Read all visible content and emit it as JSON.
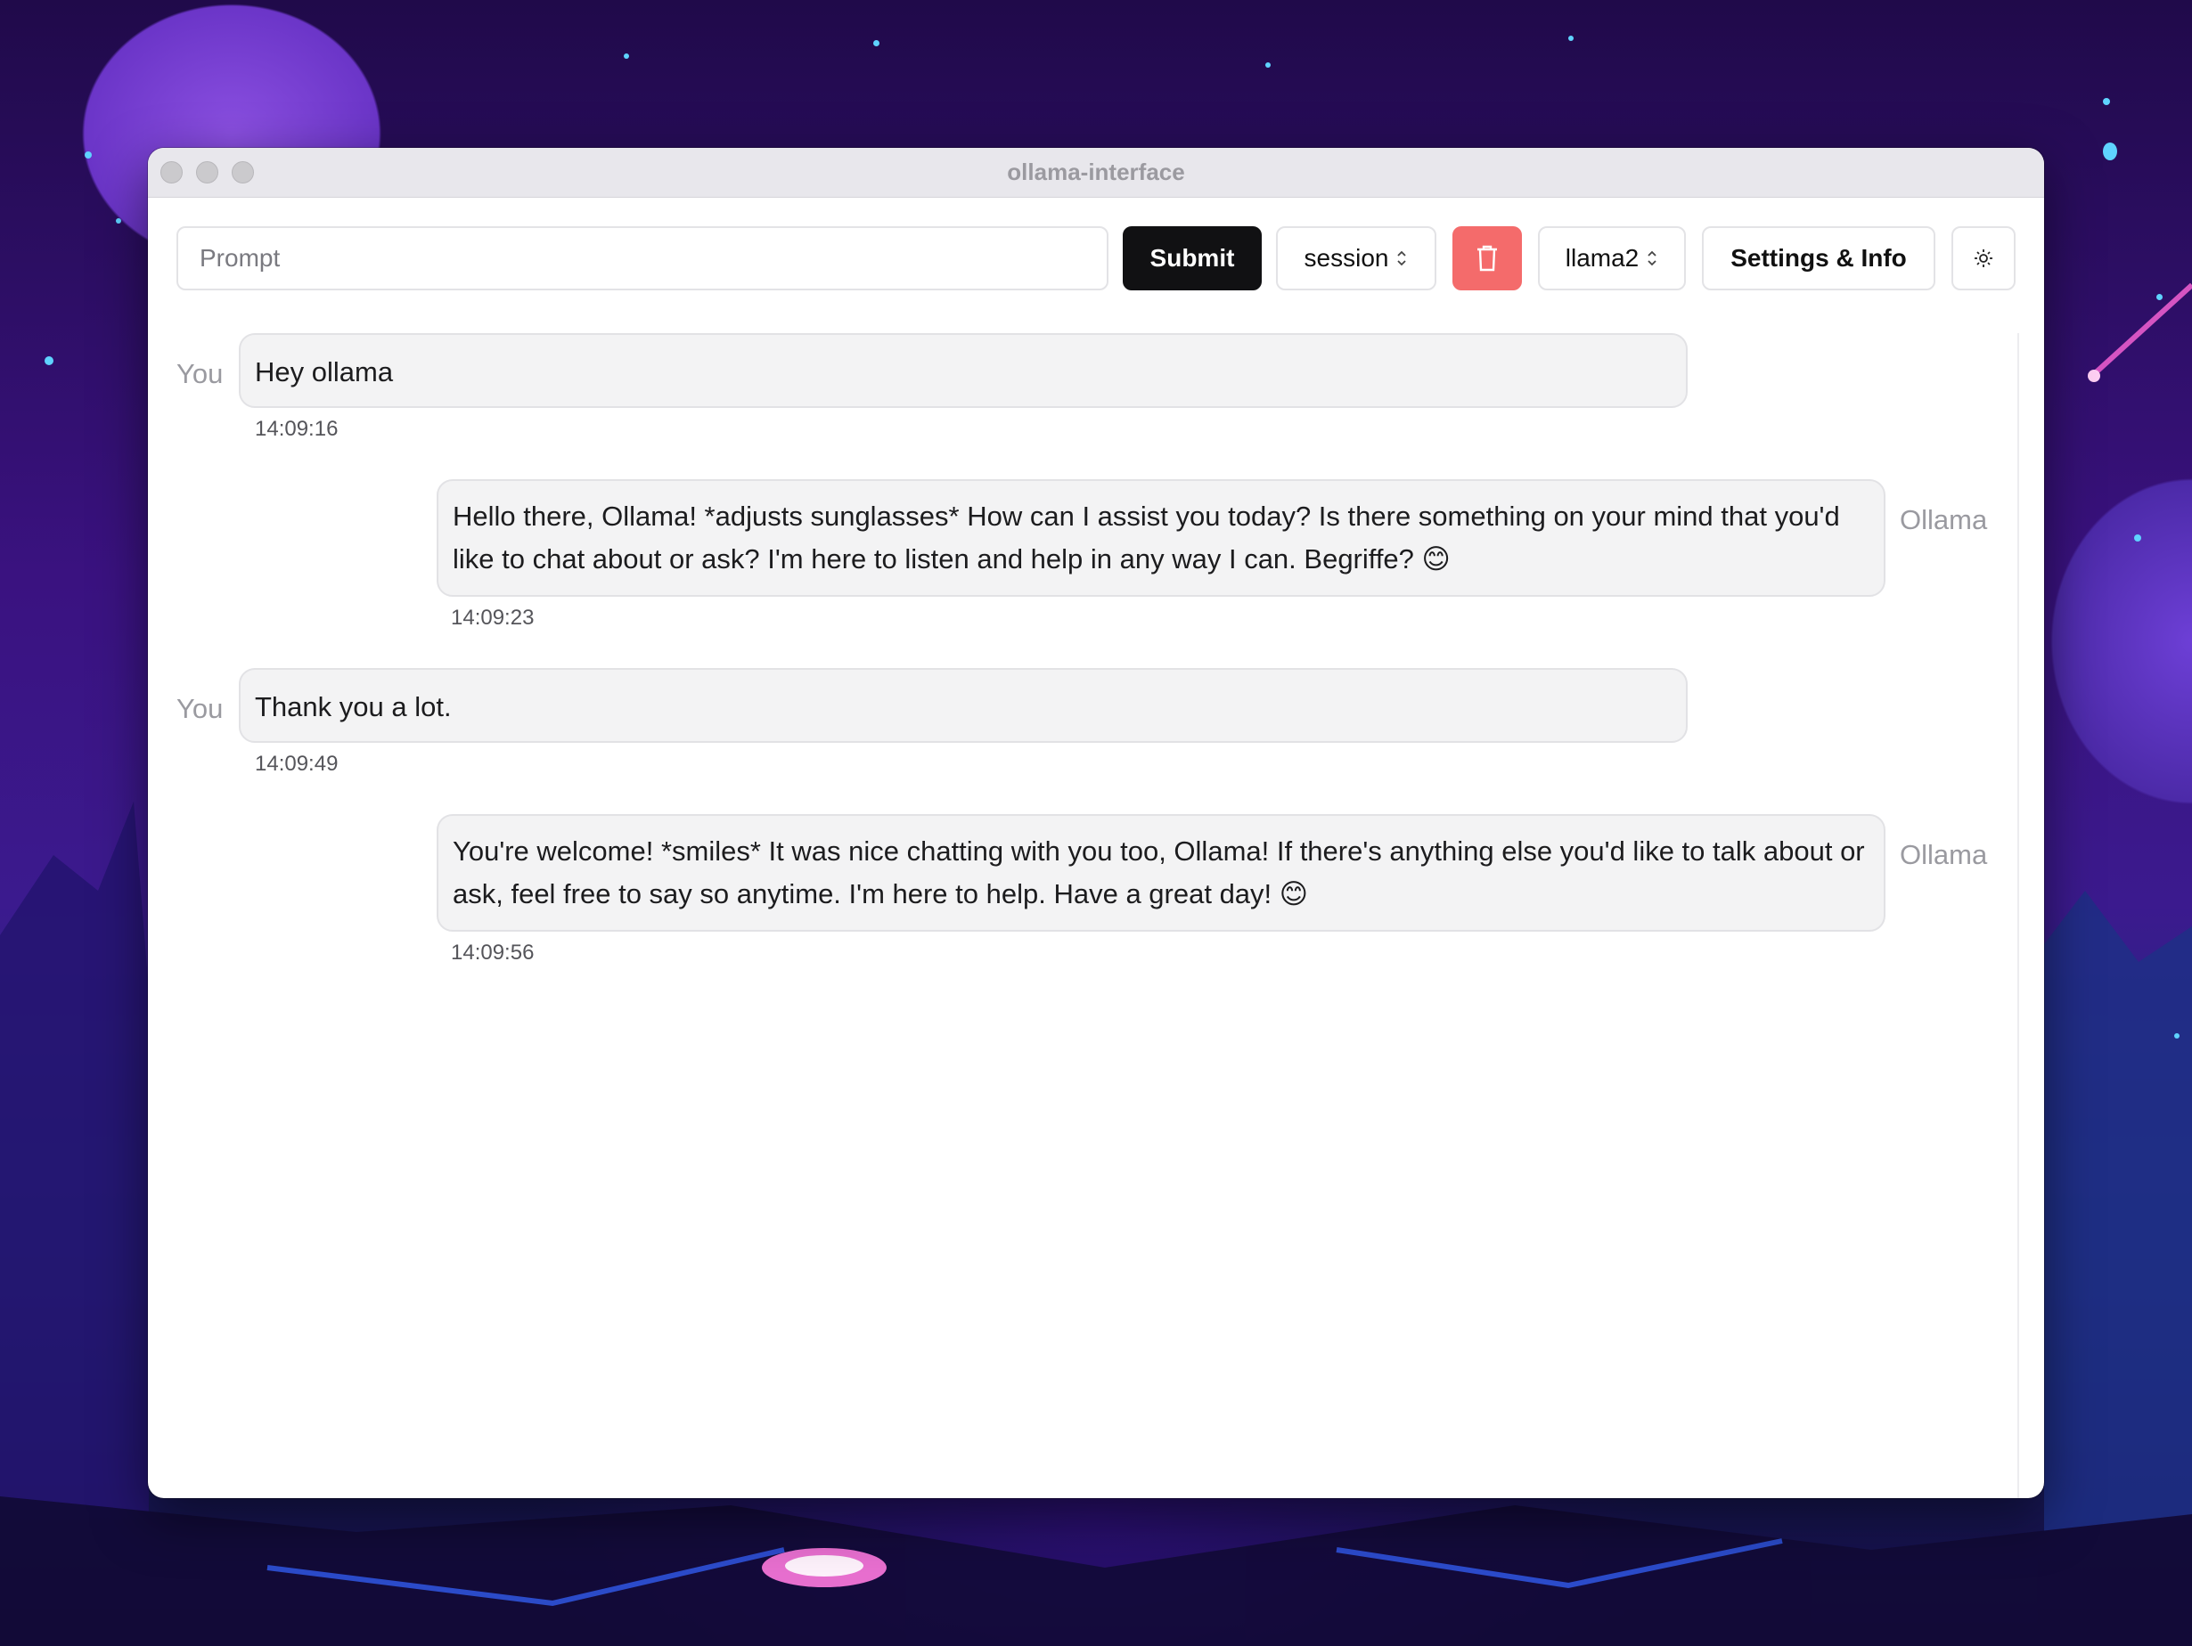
{
  "window": {
    "title": "ollama-interface"
  },
  "toolbar": {
    "prompt_placeholder": "Prompt",
    "prompt_value": "",
    "submit_label": "Submit",
    "session_label": "session",
    "model_label": "llama2",
    "settings_label": "Settings & Info",
    "delete_icon": "trash-icon",
    "theme_icon": "sun-icon"
  },
  "colors": {
    "submit_bg": "#111113",
    "delete_bg": "#f46b6b",
    "bubble_bg": "#f3f3f4"
  },
  "messages": [
    {
      "author": "You",
      "text": "Hey ollama",
      "time": "14:09:16"
    },
    {
      "author": "Ollama",
      "text": "Hello there, Ollama! *adjusts sunglasses* How can I assist you today? Is there something on your mind that you'd like to chat about or ask? I'm here to listen and help in any way I can. Begriffe? 😊",
      "time": "14:09:23"
    },
    {
      "author": "You",
      "text": "Thank you a lot.",
      "time": "14:09:49"
    },
    {
      "author": "Ollama",
      "text": "You're welcome! *smiles* It was nice chatting with you too, Ollama! If there's anything else you'd like to talk about or ask, feel free to say so anytime. I'm here to help. Have a great day! 😊",
      "time": "14:09:56"
    }
  ]
}
